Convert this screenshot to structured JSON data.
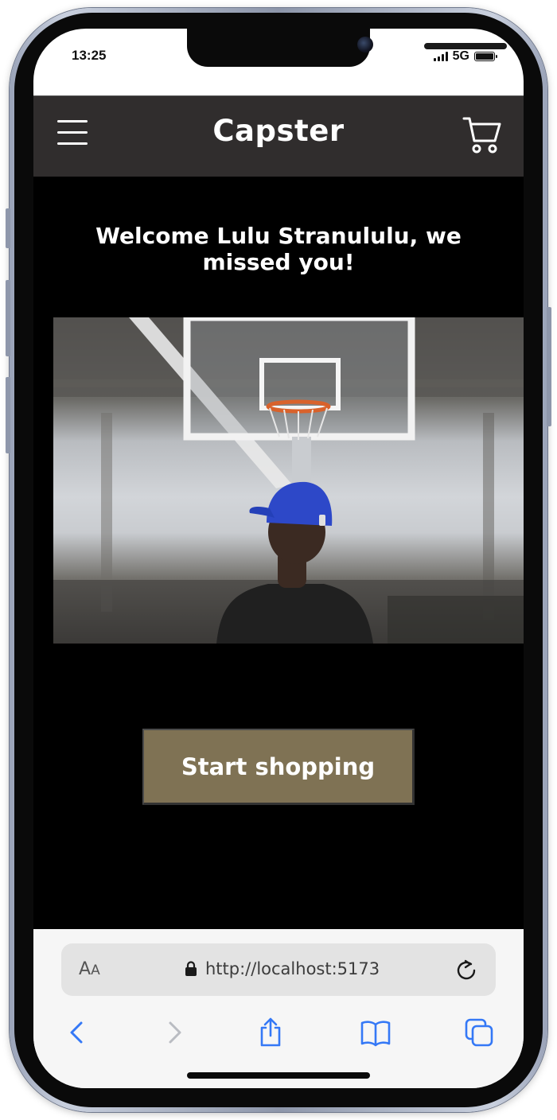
{
  "status_bar": {
    "time": "13:25",
    "network": "5G"
  },
  "header": {
    "brand": "Capster"
  },
  "main": {
    "welcome": "Welcome Lulu Stranululu, we missed you!",
    "cta_label": "Start shopping"
  },
  "browser": {
    "aa_large": "A",
    "aa_small": "A",
    "url": "http://localhost:5173"
  },
  "colors": {
    "header_bg": "#302d2d",
    "content_bg": "#000000",
    "cta_bg": "#7f7254",
    "cap_blue": "#2d48c8",
    "safari_blue": "#3478f6"
  },
  "icons": [
    "hamburger-icon",
    "cart-icon",
    "lock-icon",
    "reload-icon",
    "back-icon",
    "forward-icon",
    "share-icon",
    "bookmarks-icon",
    "tabs-icon"
  ]
}
